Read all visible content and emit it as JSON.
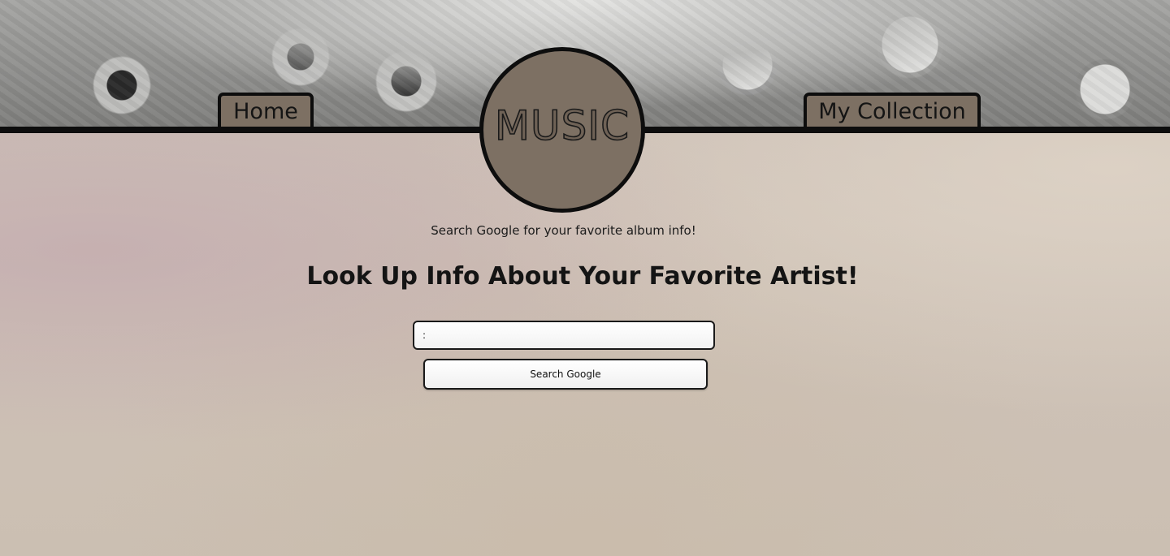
{
  "header": {
    "nav": {
      "home_label": "Home",
      "collection_label": "My Collection"
    },
    "logo_text": "MUSIC"
  },
  "main": {
    "subtitle": "Search Google for your favorite album info!",
    "heading": "Look Up Info About Your Favorite Artist!",
    "search": {
      "value": ":",
      "button_label": "Search Google"
    }
  },
  "colors": {
    "tab_background": "#7d7063",
    "outline": "#0d0d0d",
    "paper_background": "#cbbfb2"
  }
}
